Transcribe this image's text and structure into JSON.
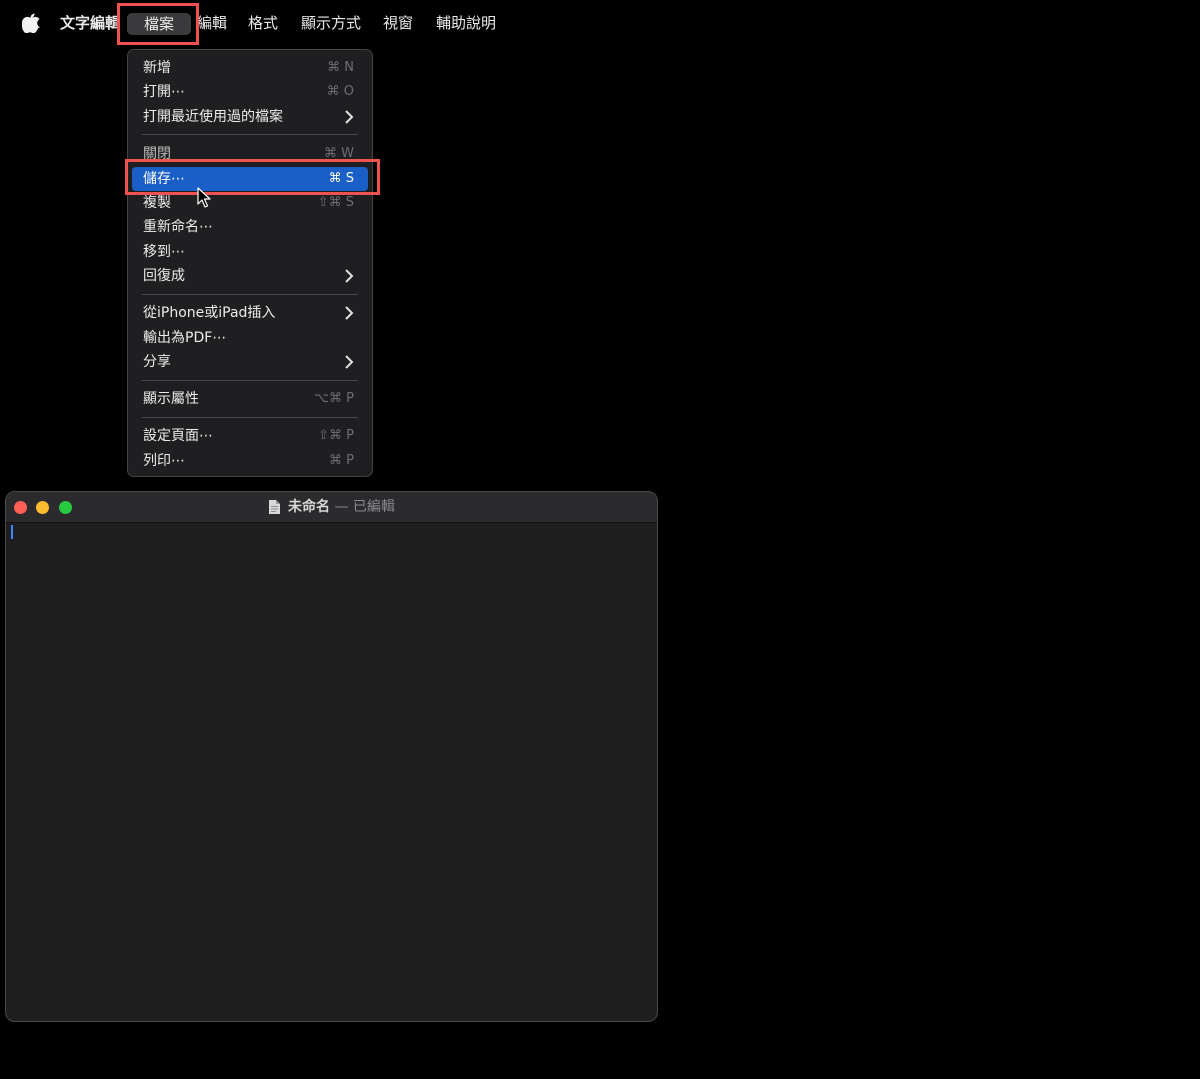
{
  "menubar": {
    "app_name": "文字編輯",
    "items": [
      "檔案",
      "編輯",
      "格式",
      "顯示方式",
      "視窗",
      "輔助說明"
    ],
    "active": "檔案"
  },
  "file_menu": {
    "items": [
      {
        "label": "新增",
        "shortcut": "⌘ N"
      },
      {
        "label": "打開⋯",
        "shortcut": "⌘ O"
      },
      {
        "label": "打開最近使用過的檔案",
        "submenu": true
      },
      {
        "label": "關閉",
        "shortcut": "⌘ W"
      },
      {
        "label": "儲存⋯",
        "shortcut": "⌘ S",
        "selected": true
      },
      {
        "label": "複製",
        "shortcut": "⇧⌘ S"
      },
      {
        "label": "重新命名⋯"
      },
      {
        "label": "移到⋯"
      },
      {
        "label": "回復成",
        "submenu": true
      },
      {
        "label": "從iPhone或iPad插入",
        "submenu": true
      },
      {
        "label": "輸出為PDF⋯"
      },
      {
        "label": "分享",
        "submenu": true
      },
      {
        "label": "顯示屬性",
        "shortcut": "⌥⌘ P"
      },
      {
        "label": "設定頁面⋯",
        "shortcut": "⇧⌘ P"
      },
      {
        "label": "列印⋯",
        "shortcut": "⌘ P"
      }
    ]
  },
  "window": {
    "title": "未命名",
    "separator": "—",
    "status": "已編輯"
  },
  "colors": {
    "highlight_box": "#ef5350",
    "selected_item": "#1a5fc7",
    "traffic_red": "#ff5f57",
    "traffic_yellow": "#febc2e",
    "traffic_green": "#28c840"
  },
  "icons": [
    "apple-logo-icon",
    "chevron-right-icon",
    "document-icon",
    "pointer-cursor-icon"
  ]
}
